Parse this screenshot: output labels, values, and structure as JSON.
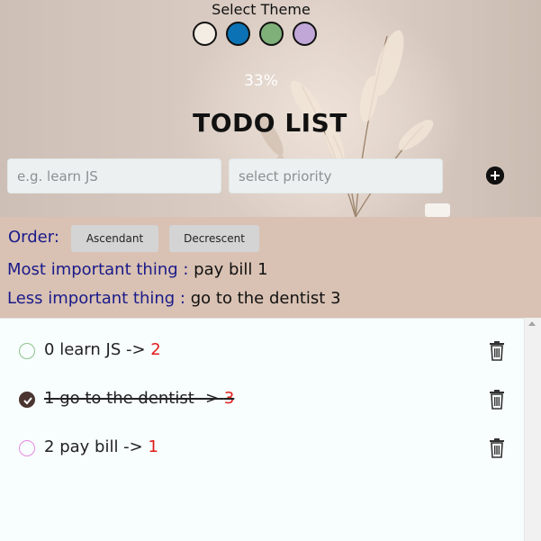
{
  "theme": {
    "label": "Select Theme",
    "swatches": [
      {
        "name": "cream",
        "color": "#f4ede4"
      },
      {
        "name": "blue",
        "color": "#0b72b5"
      },
      {
        "name": "green",
        "color": "#7fb07a"
      },
      {
        "name": "lavender",
        "color": "#c1a6d8"
      }
    ]
  },
  "progress": "33%",
  "title": "TODO LIST",
  "form": {
    "task_placeholder": "e.g. learn JS",
    "priority_placeholder": "select priority",
    "add_icon": "plus-circle-icon"
  },
  "order": {
    "label": "Order:",
    "ascending": "Ascendant",
    "descending": "Decrescent"
  },
  "summary": {
    "most_label": "Most important thing :",
    "most_value": "pay bill 1",
    "less_label": "Less important thing :",
    "less_value": "go to the dentist 3"
  },
  "todos": [
    {
      "index": "0",
      "text": "learn JS ->",
      "priority": "2",
      "done": false,
      "check_color": "#8ec28e"
    },
    {
      "index": "1",
      "text": "go to the dentist ->",
      "priority": "3",
      "done": true,
      "check_color": "#4a3530"
    },
    {
      "index": "2",
      "text": "pay bill ->",
      "priority": "1",
      "done": false,
      "check_color": "#e58be0"
    }
  ],
  "colors": {
    "accent_text": "#1a1a8a",
    "priority_text": "#e01b1b",
    "order_background": "#d9c2b3"
  }
}
